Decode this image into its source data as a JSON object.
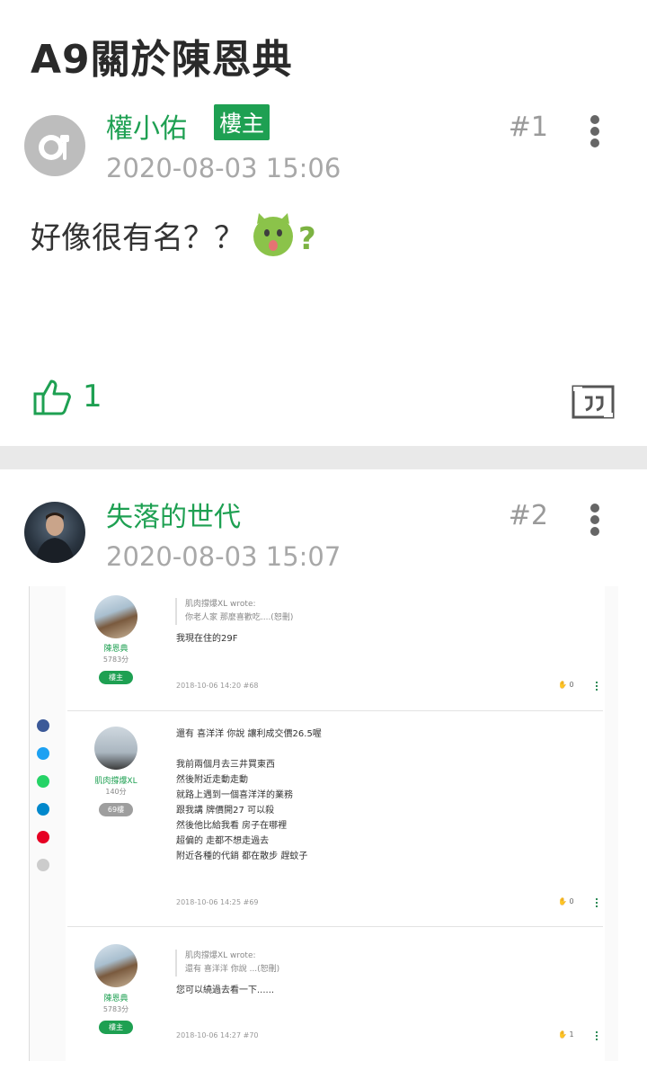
{
  "page": {
    "title": "A9關於陳恩典"
  },
  "posts": [
    {
      "username": "權小佑",
      "badge": "樓主",
      "timestamp": "2020-08-03 15:06",
      "floor": "#1",
      "body": "好像很有名？？",
      "emoji": "green-surprised-face-question-icon",
      "likes": "1"
    },
    {
      "username": "失落的世代",
      "timestamp": "2020-08-03 15:07",
      "floor": "#2"
    }
  ],
  "embedded": {
    "posts": [
      {
        "name": "陳恩典",
        "score": "5783分",
        "badge": "樓主",
        "quote_author": "肌肉撐爆XL wrote:",
        "quote_text": "你老人家 那麼喜歡吃....(恕刪)",
        "lines": [
          "我現在住的29F"
        ],
        "meta": "2018-10-06 14:20 #68",
        "likes": "0"
      },
      {
        "name": "肌肉撐爆XL",
        "score": "140分",
        "badge": "69樓",
        "lines": [
          "還有 喜洋洋 你說 讓利成交價26.5喔",
          "",
          "我前兩個月去三井買東西",
          "然後附近走動走動",
          "就路上遇到一個喜洋洋的業務",
          "跟我講 牌價開27 可以殺",
          "然後他比給我看 房子在哪裡",
          "超偏的 走都不想走過去",
          "附近各種的代銷 都在散步 趕蚊子"
        ],
        "meta": "2018-10-06 14:25 #69",
        "likes": "0"
      },
      {
        "name": "陳恩典",
        "score": "5783分",
        "badge": "樓主",
        "quote_author": "肌肉撐爆XL wrote:",
        "quote_text": "還有 喜洋洋 你說 ...(恕刪)",
        "lines": [
          "您可以繞過去看一下......"
        ],
        "meta": "2018-10-06 14:27 #70",
        "likes": "1"
      }
    ],
    "share_colors": [
      "#3b5998",
      "#1da1f2",
      "#25d366",
      "#0088cc",
      "#e60023",
      "#cccccc"
    ]
  },
  "colors": {
    "accent": "#1ea052",
    "muted": "#a8a8a8"
  }
}
